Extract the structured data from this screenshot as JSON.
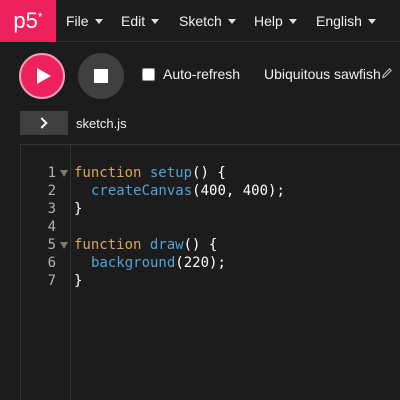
{
  "app": {
    "logo": "p5",
    "logo_mark": "*"
  },
  "menu": {
    "items": [
      {
        "label": "File"
      },
      {
        "label": "Edit"
      },
      {
        "label": "Sketch"
      },
      {
        "label": "Help"
      },
      {
        "label": "English"
      }
    ]
  },
  "toolbar": {
    "auto_refresh_label": "Auto-refresh",
    "auto_refresh_checked": false,
    "sketch_name": "Ubiquitous sawfish",
    "play_color": "#ed225d"
  },
  "file": {
    "name": "sketch.js"
  },
  "editor": {
    "line_numbers": [
      "1",
      "2",
      "3",
      "4",
      "5",
      "6",
      "7"
    ],
    "lines": [
      {
        "kw": "function",
        "fn": "setup",
        "rest": "() {"
      },
      {
        "fn": "createCanvas",
        "rest": "(400, 400);"
      },
      {
        "rest": "}"
      },
      {
        "rest": ""
      },
      {
        "kw": "function",
        "fn": "draw",
        "rest": "() {"
      },
      {
        "fn": "background",
        "rest": "(220);"
      },
      {
        "rest": "}"
      }
    ]
  },
  "colors": {
    "accent": "#ed225d",
    "keyword": "#d8a656",
    "function": "#4fa3d9",
    "background": "#1c1c1c"
  }
}
